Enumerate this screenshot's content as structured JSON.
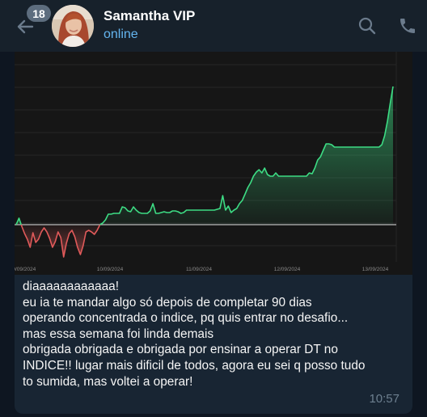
{
  "header": {
    "unread_count": "18",
    "contact_name": "Samantha VIP",
    "status": "online"
  },
  "icons": {
    "back": "arrow-left",
    "search": "magnifier",
    "call": "phone-handset"
  },
  "colors": {
    "header_bg": "#17212b",
    "chat_bg": "#0e1621",
    "bubble_bg": "#182533",
    "status_blue": "#64b5ef",
    "chart_up": "#3ddc84",
    "chart_down": "#e05a5a"
  },
  "message": {
    "chart": {
      "x_tick_labels": [
        "09/09/2024",
        "10/09/2024",
        "11/09/2024",
        "12/09/2024",
        "13/09/2024"
      ]
    },
    "lines": [
      "diaaaaaaaaaaaa!",
      "eu ia te mandar algo só depois de completar 90 dias",
      "operando concentrada o indice, pq quis entrar no desafio...",
      "mas essa semana foi linda demais",
      "obrigada obrigada e obrigada por ensinar a operar DT no",
      "INDICE!! lugar mais dificil de todos, agora eu sei q posso tudo",
      "to sumida, mas voltei a operar!"
    ],
    "time": "10:57"
  },
  "chart_data": {
    "type": "area",
    "baseline": 0,
    "x_tick_labels": [
      "09/09/2024",
      "10/09/2024",
      "11/09/2024",
      "12/09/2024",
      "13/09/2024"
    ],
    "series": [
      {
        "values": [
          0,
          8,
          -2,
          -11,
          -18,
          -28,
          -10,
          -22,
          -18,
          -9,
          -4,
          -9,
          -17,
          -28,
          -21,
          -9,
          -16,
          -40,
          -23,
          -11,
          -7,
          -15,
          -28,
          -37,
          -26,
          -9,
          -7,
          -9,
          -12,
          -7,
          0,
          2,
          6,
          13,
          13,
          14,
          14,
          14,
          22,
          21,
          17,
          16,
          22,
          18,
          15,
          14,
          14,
          14,
          17,
          26,
          14,
          14,
          15,
          16,
          15,
          15,
          17,
          17,
          16,
          14,
          15,
          18,
          18,
          18,
          18,
          18,
          18,
          18,
          18,
          18,
          18,
          18,
          19,
          20,
          36,
          18,
          23,
          15,
          18,
          20,
          26,
          30,
          38,
          46,
          52,
          60,
          65,
          68,
          64,
          70,
          62,
          60,
          60,
          64,
          60,
          60,
          60,
          60,
          60,
          60,
          60,
          60,
          60,
          60,
          60,
          64,
          63,
          70,
          80,
          84,
          92,
          100,
          100,
          99,
          96,
          96,
          96,
          96,
          96,
          96,
          96,
          96,
          96,
          96,
          96,
          96,
          96,
          96,
          96,
          96,
          96,
          99,
          110,
          128,
          150,
          171
        ]
      }
    ],
    "grid": true,
    "legend": "none"
  }
}
